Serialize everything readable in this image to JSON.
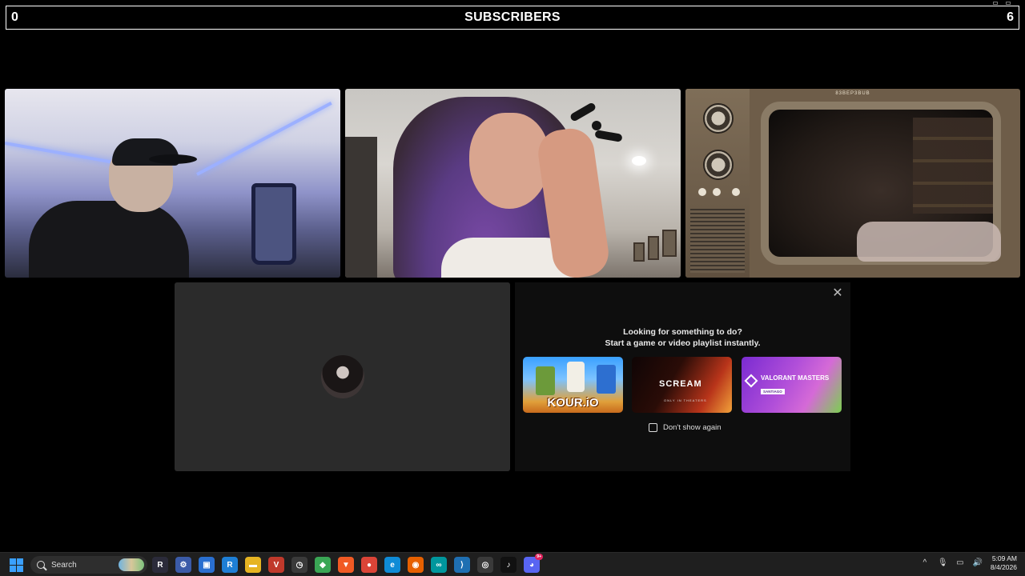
{
  "counter": {
    "left_value": "0",
    "title": "SUBSCRIBERS",
    "right_value": "6"
  },
  "tiles": {
    "tv_brand": "83BEP3BUB"
  },
  "activity": {
    "line1": "Looking for something to do?",
    "line2": "Start a game or video playlist instantly.",
    "close_glyph": "✕",
    "cards": [
      {
        "label": "KOUR.iO"
      },
      {
        "label": "SCREAM",
        "sub": "ONLY IN THEATERS"
      },
      {
        "label": "VALORANT MASTERS",
        "tag": "SANTIAGO"
      }
    ],
    "dont_show": "Don't show again"
  },
  "taskbar": {
    "search_placeholder": "Search",
    "apps": [
      {
        "name": "terminal-r-icon",
        "color": "#2b2b3a",
        "glyph": "R"
      },
      {
        "name": "network-icon",
        "color": "#3b5ba8",
        "glyph": "⚙"
      },
      {
        "name": "remote-desktop-icon",
        "color": "#2a6fd0",
        "glyph": "▣"
      },
      {
        "name": "app-blue-icon",
        "color": "#1e7fd6",
        "glyph": "R"
      },
      {
        "name": "file-explorer-icon",
        "color": "#e6b422",
        "glyph": "▬"
      },
      {
        "name": "voice-app-icon",
        "color": "#c0392b",
        "glyph": "V"
      },
      {
        "name": "speedometer-icon",
        "color": "#3a3a3a",
        "glyph": "◷"
      },
      {
        "name": "shield-browser-icon",
        "color": "#3aa655",
        "glyph": "◆"
      },
      {
        "name": "brave-icon",
        "color": "#f15a24",
        "glyph": "▼"
      },
      {
        "name": "chrome-icon",
        "color": "#db4437",
        "glyph": "●"
      },
      {
        "name": "edge-icon",
        "color": "#0f8bd6",
        "glyph": "e"
      },
      {
        "name": "firefox-icon",
        "color": "#e66000",
        "glyph": "◉"
      },
      {
        "name": "arduino-icon",
        "color": "#00979d",
        "glyph": "∞"
      },
      {
        "name": "vscode-icon",
        "color": "#1f6fb2",
        "glyph": "⟩"
      },
      {
        "name": "obs-icon",
        "color": "#3a3a3a",
        "glyph": "◎"
      },
      {
        "name": "tiktok-icon",
        "color": "#111111",
        "glyph": "♪"
      },
      {
        "name": "discord-icon",
        "color": "#5865f2",
        "glyph": "◕",
        "badge": "9+"
      }
    ],
    "tray": {
      "chevron": "^",
      "mic": "🎙",
      "display": "▭",
      "volume": "🔊"
    },
    "time": "5:09 AM",
    "date": "8/4/2026"
  }
}
